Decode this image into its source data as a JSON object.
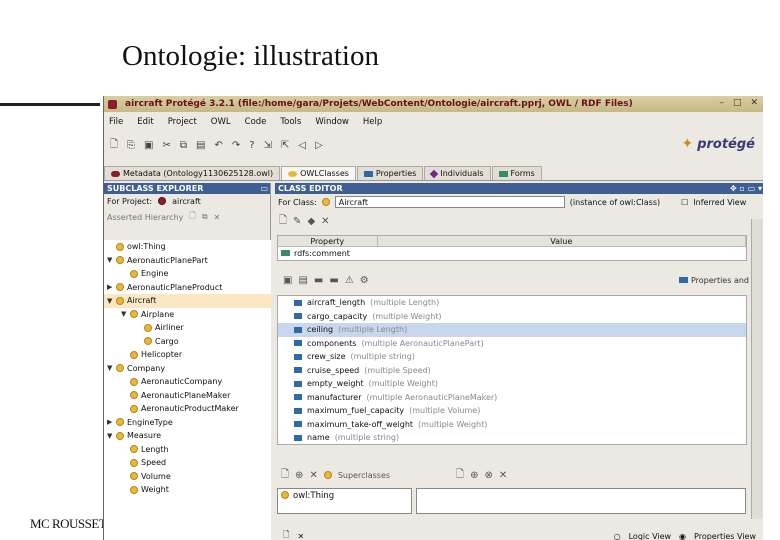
{
  "slide": {
    "title": "Ontologie: illustration",
    "footer": "MC ROUSSET"
  },
  "window": {
    "title": "aircraft  Protégé 3.2.1    (file:/home/gara/Projets/WebContent/Ontologie/aircraft.pprj, OWL / RDF Files)",
    "buttons": [
      "–",
      "□",
      "✕"
    ]
  },
  "menu": [
    "File",
    "Edit",
    "Project",
    "OWL",
    "Code",
    "Tools",
    "Window",
    "Help"
  ],
  "toolbar_icons": [
    "new-icon",
    "open-icon",
    "save-icon",
    "cut-icon",
    "copy-icon",
    "paste-icon",
    "undo-icon",
    "redo-icon",
    "query-icon",
    "export-icon",
    "import-icon",
    "back-icon",
    "forward-icon"
  ],
  "logo": "protégé",
  "tabs": [
    {
      "label": "Metadata (Ontology1130625128.owl)",
      "color": "#8b1e2c"
    },
    {
      "label": "OWLClasses",
      "color": "#e8b83a"
    },
    {
      "label": "Properties",
      "color": "#2d6aa6"
    },
    {
      "label": "Individuals",
      "color": "#6a2a8a"
    },
    {
      "label": "Forms",
      "color": "#3a8a6a"
    }
  ],
  "subclass_explorer": {
    "header": "SUBCLASS EXPLORER",
    "for_project_label": "For Project:",
    "project": "aircraft",
    "asserted_label": "Asserted Hierarchy",
    "tree": [
      {
        "label": "owl:Thing",
        "depth": 0,
        "toggle": ""
      },
      {
        "label": "AeronauticPlanePart",
        "depth": 0,
        "toggle": "▼"
      },
      {
        "label": "Engine",
        "depth": 1,
        "toggle": ""
      },
      {
        "label": "AeronauticPlaneProduct",
        "depth": 0,
        "toggle": "▶"
      },
      {
        "label": "Aircraft",
        "depth": 0,
        "toggle": "▼",
        "selected": true
      },
      {
        "label": "Airplane",
        "depth": 1,
        "toggle": "▼"
      },
      {
        "label": "Airliner",
        "depth": 2,
        "toggle": ""
      },
      {
        "label": "Cargo",
        "depth": 2,
        "toggle": ""
      },
      {
        "label": "Helicopter",
        "depth": 1,
        "toggle": ""
      },
      {
        "label": "Company",
        "depth": 0,
        "toggle": "▼"
      },
      {
        "label": "AeronauticCompany",
        "depth": 1,
        "toggle": ""
      },
      {
        "label": "AeronauticPlaneMaker",
        "depth": 1,
        "toggle": ""
      },
      {
        "label": "AeronauticProductMaker",
        "depth": 1,
        "toggle": ""
      },
      {
        "label": "EngineType",
        "depth": 0,
        "toggle": "▶"
      },
      {
        "label": "Measure",
        "depth": 0,
        "toggle": "▼"
      },
      {
        "label": "Length",
        "depth": 1,
        "toggle": ""
      },
      {
        "label": "Speed",
        "depth": 1,
        "toggle": ""
      },
      {
        "label": "Volume",
        "depth": 1,
        "toggle": ""
      },
      {
        "label": "Weight",
        "depth": 1,
        "toggle": ""
      }
    ]
  },
  "class_editor": {
    "header": "CLASS EDITOR",
    "for_class_label": "For Class:",
    "class_name": "Aircraft",
    "instance_of": "(instance of owl:Class)",
    "inferred_view": "Inferred View",
    "table_headers": [
      "Property",
      "Value"
    ],
    "table_row": "rdfs:comment",
    "properties_label": "Properties and",
    "properties": [
      {
        "name": "aircraft_length",
        "type": "(multiple Length)"
      },
      {
        "name": "cargo_capacity",
        "type": "(multiple Weight)"
      },
      {
        "name": "ceiling",
        "type": "(multiple Length)",
        "selected": true
      },
      {
        "name": "components",
        "type": "(multiple AeronauticPlanePart)"
      },
      {
        "name": "crew_size",
        "type": "(multiple string)"
      },
      {
        "name": "cruise_speed",
        "type": "(multiple Speed)"
      },
      {
        "name": "empty_weight",
        "type": "(multiple Weight)"
      },
      {
        "name": "manufacturer",
        "type": "(multiple AeronauticPlaneMaker)"
      },
      {
        "name": "maximum_fuel_capacity",
        "type": "(multiple Volume)"
      },
      {
        "name": "maximum_take-off_weight",
        "type": "(multiple Weight)"
      },
      {
        "name": "name",
        "type": "(multiple string)"
      }
    ],
    "superclasses_label": "Superclasses",
    "superclass": "owl:Thing",
    "view_options": [
      "Logic View",
      "Properties View"
    ],
    "selected_view": "Properties View"
  }
}
